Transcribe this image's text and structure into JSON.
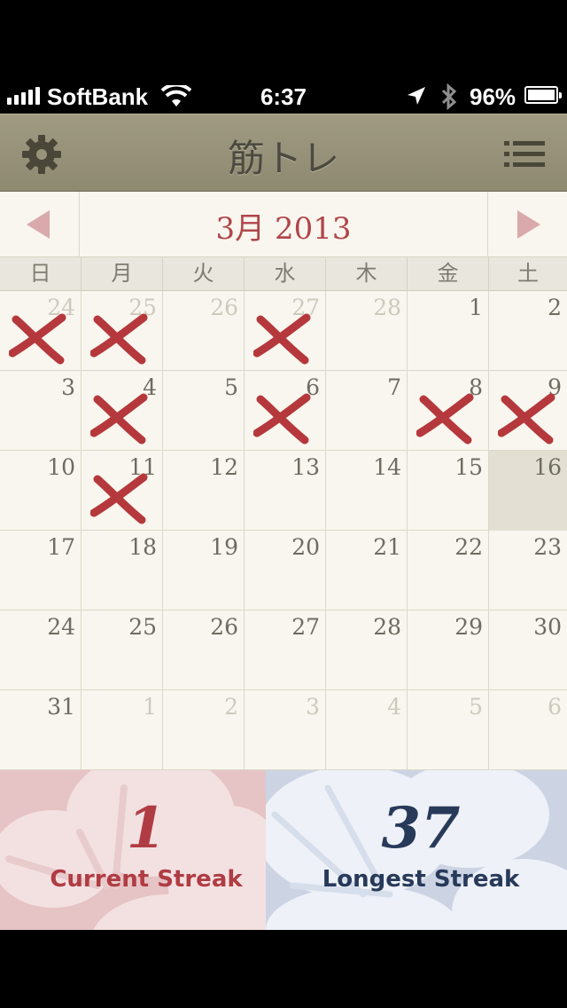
{
  "status_bar": {
    "carrier": "SoftBank",
    "time": "6:37",
    "battery": "96%"
  },
  "nav": {
    "title": "筋トレ",
    "left_icon": "gear-icon",
    "right_icon": "list-icon"
  },
  "calendar": {
    "month_title": "3月 2013",
    "weekdays": [
      "日",
      "月",
      "火",
      "水",
      "木",
      "金",
      "土"
    ],
    "weeks": [
      [
        {
          "d": "24",
          "other": true,
          "x": true
        },
        {
          "d": "25",
          "other": true,
          "x": true
        },
        {
          "d": "26",
          "other": true
        },
        {
          "d": "27",
          "other": true,
          "x": true
        },
        {
          "d": "28",
          "other": true
        },
        {
          "d": "1"
        },
        {
          "d": "2"
        }
      ],
      [
        {
          "d": "3"
        },
        {
          "d": "4",
          "x": true
        },
        {
          "d": "5"
        },
        {
          "d": "6",
          "x": true
        },
        {
          "d": "7"
        },
        {
          "d": "8",
          "x": true
        },
        {
          "d": "9",
          "x": true
        }
      ],
      [
        {
          "d": "10"
        },
        {
          "d": "11",
          "x": true
        },
        {
          "d": "12"
        },
        {
          "d": "13"
        },
        {
          "d": "14"
        },
        {
          "d": "15"
        },
        {
          "d": "16",
          "today": true
        }
      ],
      [
        {
          "d": "17"
        },
        {
          "d": "18"
        },
        {
          "d": "19"
        },
        {
          "d": "20"
        },
        {
          "d": "21"
        },
        {
          "d": "22"
        },
        {
          "d": "23"
        }
      ],
      [
        {
          "d": "24"
        },
        {
          "d": "25"
        },
        {
          "d": "26"
        },
        {
          "d": "27"
        },
        {
          "d": "28"
        },
        {
          "d": "29"
        },
        {
          "d": "30"
        }
      ],
      [
        {
          "d": "31"
        },
        {
          "d": "1",
          "other": true
        },
        {
          "d": "2",
          "other": true
        },
        {
          "d": "3",
          "other": true
        },
        {
          "d": "4",
          "other": true
        },
        {
          "d": "5",
          "other": true
        },
        {
          "d": "6",
          "other": true
        }
      ]
    ]
  },
  "streaks": {
    "current_value": "1",
    "current_label": "Current Streak",
    "longest_value": "37",
    "longest_label": "Longest Streak"
  },
  "colors": {
    "accent_red": "#b03c43",
    "accent_navy": "#283a5a",
    "nav_bar": "#9a957d"
  }
}
